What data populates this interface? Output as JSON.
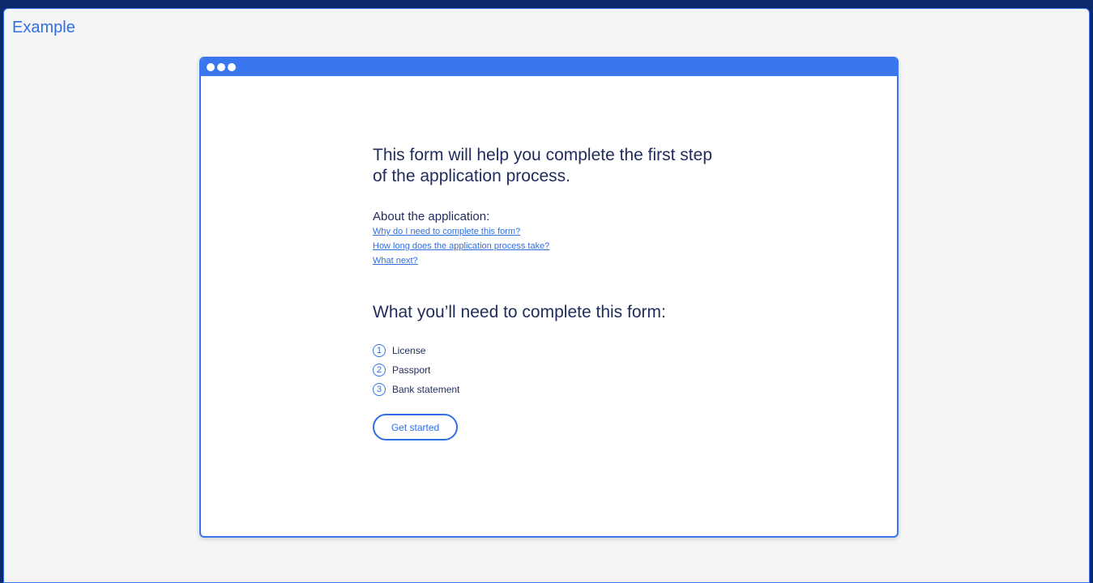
{
  "panel": {
    "title": "Example"
  },
  "page": {
    "heading": "This form will help you complete the first step of the application process.",
    "about_label": "About the application:",
    "links": [
      "Why do I need to complete this form?",
      "How long does the application process take?",
      "What next?"
    ],
    "requirements_heading": "What you’ll need to complete this form:",
    "requirements": [
      {
        "number": "1",
        "label": "License"
      },
      {
        "number": "2",
        "label": "Passport"
      },
      {
        "number": "3",
        "label": "Bank statement"
      }
    ],
    "start_button": "Get started"
  },
  "colors": {
    "accent": "#2f6fe3",
    "frame": "#3a76ee",
    "text": "#1f2c5c",
    "outer_background": "#0b2a6b"
  }
}
